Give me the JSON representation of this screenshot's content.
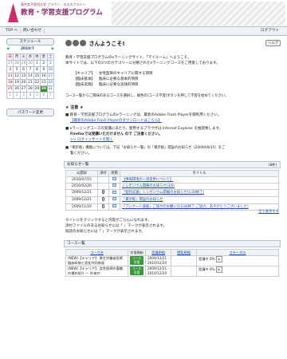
{
  "header": {
    "org": "東京女子医科大学 ブラウン・スエスクライン",
    "title": "教育・学習支援プログラム"
  },
  "nav": {
    "top": "TOP へ",
    "contact": "問い合わせ",
    "logout": "ログアウト"
  },
  "sidebar": {
    "schedule_btn": "スケジュール",
    "cal_prev": "◀",
    "cal_next": "▶",
    "cal_title": "2010/7",
    "weekdays": [
      "日",
      "月",
      "火",
      "水",
      "木",
      "金",
      "土"
    ],
    "weeks": [
      [
        "27",
        "28",
        "29",
        "30",
        "1",
        "2",
        "3"
      ],
      [
        "4",
        "5",
        "6",
        "7",
        "8",
        "9",
        "10"
      ],
      [
        "11",
        "12",
        "13",
        "14",
        "15",
        "16",
        "17"
      ],
      [
        "18",
        "19",
        "20",
        "21",
        "22",
        "23",
        "24"
      ],
      [
        "25",
        "26",
        "27",
        "28",
        "29",
        "30",
        "31"
      ],
      [
        "1",
        "2",
        "3",
        "4",
        "5",
        "6",
        "7"
      ]
    ],
    "password_btn": "パスワード変更"
  },
  "main": {
    "greeting": "さんようこそ!",
    "help": "ヘルプ",
    "intro1": "教育・学習支援プログラムのeラーニングサイト、「マイルーム」へようこそ。",
    "intro2": "本サイトでは、以下の3つのカテゴリーに分類されたeラーニングコースをご用意しております。",
    "categories": [
      {
        "term": "【キャリア】",
        "desc": "女性医師のキャリアに関する項目"
      },
      {
        "term": "【臨床基本】",
        "desc": "臨床に必要な基本的項目"
      },
      {
        "term": "【臨床実践】",
        "desc": "臨床に必要な実践的項目"
      }
    ],
    "course_hint": "コース一覧からご興味のあるコースを選択し、緑色の[コース学習]ボタンを押して学習を始めてください。",
    "notice_head": "★ 注意 ★",
    "notice1": "■ 教育・学習支援プログラムのeラーニングは、最新のAdobe Flash Playerを御利用ください。",
    "notice1_link": "【最新のAdobe Flash Playerのダウンロードはこちら】",
    "notice2": "■ eラーニングコースの受講にあたり、使用するブラウザは Internet Explorer を推奨致します。",
    "notice2b": "Firefoxでは受講いただけません ので ご注意ください。",
    "notice2_link": ">> ログインサイトを開く",
    "notice3": "■「掲示板」機能については、下記「お知らせ一覧」の「掲示板」開設のお知らせ（2009/09/15）をご",
    "notice3b": "覧ください。",
    "news_title": "お知らせ一覧",
    "news_count": "(8件)",
    "news_headers": [
      "公開日",
      "添付",
      "状態",
      "タイトル"
    ],
    "news": [
      {
        "date": "2010/07/15",
        "title": "【情報環境の一部変更について】"
      },
      {
        "date": "2010/02/26",
        "title": "シンポジウム開催のお知らせ(3/6)"
      },
      {
        "date": "2009/12/21",
        "title": "「個別支援」シンポジウム開催のお知らせ(1/30終了)"
      },
      {
        "date": "2009/12/21",
        "title": "「掲示板」開設のお知らせ"
      },
      {
        "date": "2009/11/16",
        "title": "「アンケート調査」ご協力のお願い(11/30終了,ご協力、ありがとうございました)"
      }
    ],
    "news_more": "全て表示する",
    "hint1": "タイトルをクリックすると内容がごらんになれます。",
    "hint2": "添付ファイルのあるお知らせには「 」マークが表示されます。",
    "hint3": "既読のお知らせには「 」マークが表示されます。",
    "course_title": "コース一覧",
    "course_headers": [
      "コース名",
      "学習開始",
      "受講期間",
      "閲覧期間",
      "ステータス"
    ],
    "courses": [
      {
        "name": "(NEW)【キャリア】 厚生労働省医師臨床研修と男女共同参画",
        "start": "コース学習",
        "period": "2009/12/21 - 2010/12/20",
        "status": "受講中 0%"
      },
      {
        "name": "(NEW)【キャリア】 女性医師の復職の場の紹介 — 外来の",
        "start": "コース学習",
        "period": "2009/12/21 - 2010/12/20",
        "status": "受講中 0%"
      }
    ]
  }
}
